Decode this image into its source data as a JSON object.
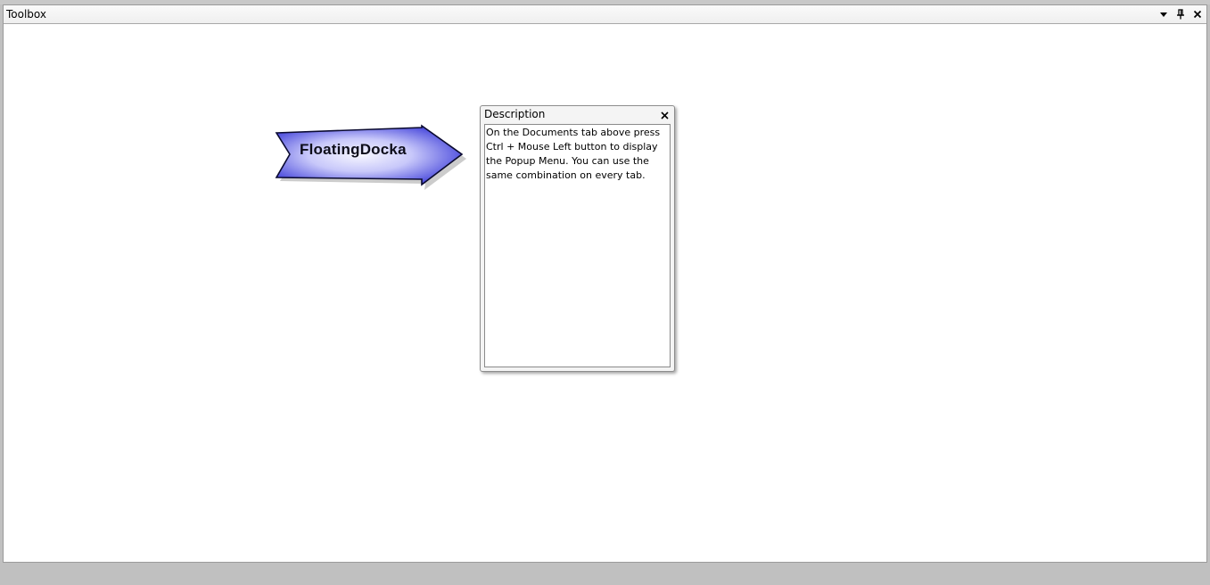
{
  "toolbox": {
    "title": "Toolbox",
    "icons": {
      "dropdown": "chevron-down-icon",
      "pin": "pin-icon",
      "close": "close-icon"
    }
  },
  "arrow": {
    "label": "FloatingDocka",
    "colors": {
      "edge": "#3a3ad8",
      "center": "#f6f6ff",
      "outline": "#0a0a30"
    }
  },
  "description_panel": {
    "title": "Description",
    "text": "On the Documents tab above press Ctrl + Mouse Left button to display the Popup Menu. You can use the same combination on every tab."
  }
}
